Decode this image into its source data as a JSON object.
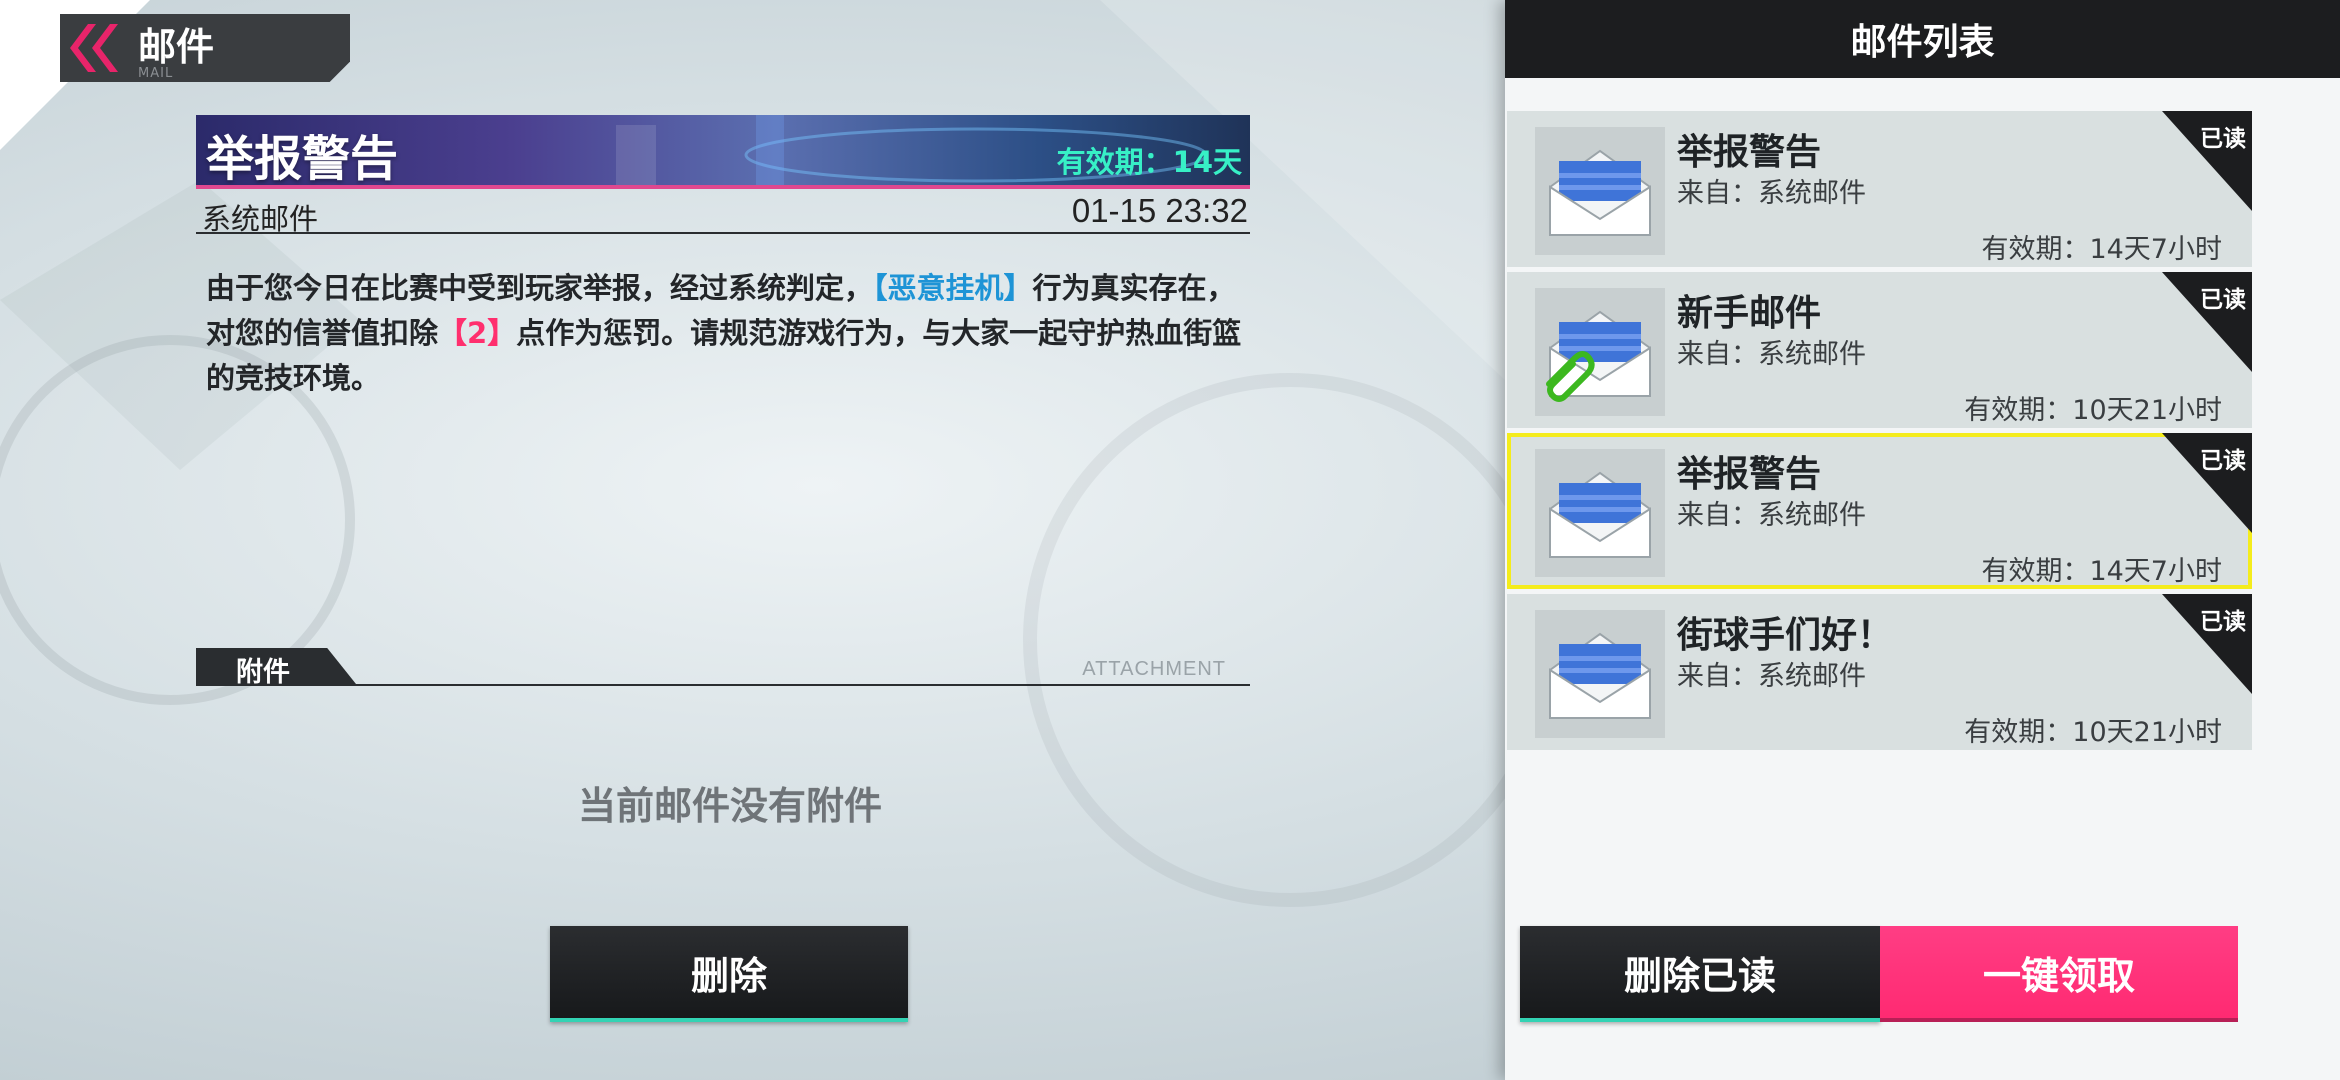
{
  "header": {
    "title": "邮件",
    "subtitle": "MAIL"
  },
  "detail": {
    "subject": "举报警告",
    "validity": "有效期：14天",
    "from": "系统邮件",
    "time": "01-15 23:32",
    "body_part1": "由于您今日在比赛中受到玩家举报，经过系统判定，",
    "body_highlight1": "【恶意挂机】",
    "body_part2": "行为真实存在，对您的信誉值扣除",
    "body_highlight2": "【2】",
    "body_part3": "点作为惩罚。请规范游戏行为，与大家一起守护热血街篮的竞技环境。"
  },
  "attachment": {
    "label": "附件",
    "label_en": "ATTACHMENT",
    "empty_text": "当前邮件没有附件"
  },
  "buttons": {
    "delete": "删除",
    "delete_read": "删除已读",
    "claim_all": "一键领取"
  },
  "mail_list": {
    "title": "邮件列表",
    "items": [
      {
        "subject": "举报警告",
        "from": "来自：系统邮件",
        "validity": "有效期：14天7小时",
        "status": "已读",
        "icon": "envelope-icon"
      },
      {
        "subject": "新手邮件",
        "from": "来自：系统邮件",
        "validity": "有效期：10天21小时",
        "status": "已读",
        "icon": "envelope-with-paperclip-icon"
      },
      {
        "subject": "举报警告",
        "from": "来自：系统邮件",
        "validity": "有效期：14天7小时",
        "status": "已读",
        "icon": "envelope-icon"
      },
      {
        "subject": "街球手们好！",
        "from": "来自：系统邮件",
        "validity": "有效期：10天21小时",
        "status": "已读",
        "icon": "envelope-icon"
      }
    ]
  },
  "colors": {
    "accent_pink": "#ff2a72",
    "validity_green": "#37f0c6",
    "highlight_blue": "#1e94d6",
    "selection_yellow": "#f4ec1c"
  }
}
